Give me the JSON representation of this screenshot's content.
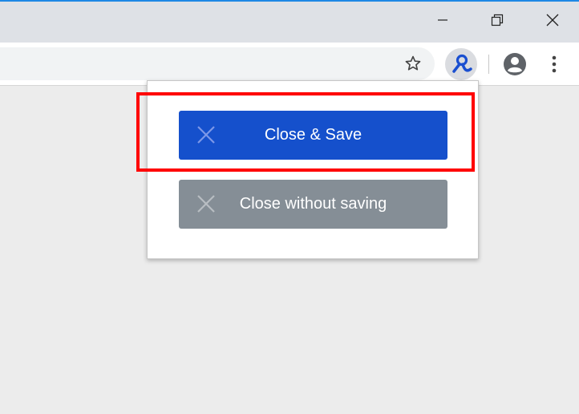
{
  "window_controls": {
    "minimize": "minimize-icon",
    "restore": "restore-icon",
    "close": "close-icon"
  },
  "toolbar": {
    "bookmark_icon": "star-outline-icon",
    "extension_icon": "extension-logo-icon",
    "profile_icon": "account-circle-icon",
    "menu_icon": "three-dots-vertical-icon"
  },
  "popup": {
    "save_button_label": "Close & Save",
    "nosave_button_label": "Close without saving"
  },
  "colors": {
    "accent_top": "#1e88e5",
    "save_button": "#1550cc",
    "nosave_button": "#858e96",
    "highlight": "#ff0000"
  }
}
